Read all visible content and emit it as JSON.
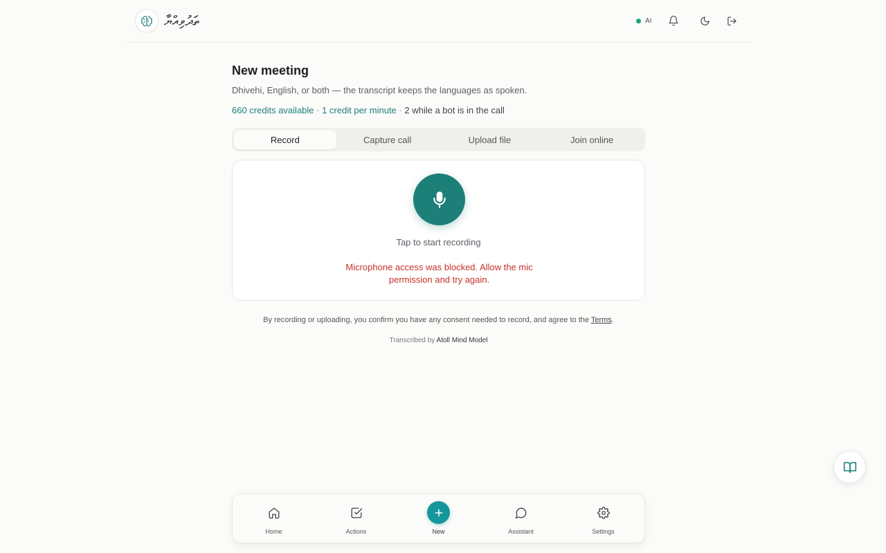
{
  "header": {
    "logo_text": "ތަދުވިއްޔާ",
    "ai_label": "AI",
    "icons": [
      "bell-icon",
      "moon-icon",
      "logout-icon"
    ]
  },
  "main": {
    "title": "New meeting",
    "subtitle": "Dhivehi, English, or both — the transcript keeps the languages as spoken.",
    "credits_available": "660 credits available",
    "credit_rate": "1 credit per minute",
    "bot_rate": "2 while a bot is in the call",
    "separator": "·",
    "tabs": [
      {
        "label": "Record",
        "active": true
      },
      {
        "label": "Capture call",
        "active": false
      },
      {
        "label": "Upload file",
        "active": false
      },
      {
        "label": "Join online",
        "active": false
      }
    ],
    "recorder": {
      "tap_text": "Tap to start recording",
      "error_text": "Microphone access was blocked. Allow the mic permission and try again."
    },
    "consent_text": "By recording or uploading, you confirm you have any consent needed to record, and agree to the",
    "terms_link": "Terms",
    "consent_end": ".",
    "transcribed_by": "Transcribed by",
    "model_name": "Atoll Mind Model"
  },
  "nav": {
    "items": [
      {
        "label": "Home",
        "icon": "home-icon"
      },
      {
        "label": "Actions",
        "icon": "checkbox-icon"
      },
      {
        "label": "New",
        "icon": "plus-icon"
      },
      {
        "label": "Assistant",
        "icon": "chat-icon"
      },
      {
        "label": "Settings",
        "icon": "gear-icon"
      }
    ]
  },
  "colors": {
    "accent": "#1c7f78",
    "new_button": "#15969a",
    "error": "#c6312b",
    "status_dot": "#1aa37a"
  }
}
